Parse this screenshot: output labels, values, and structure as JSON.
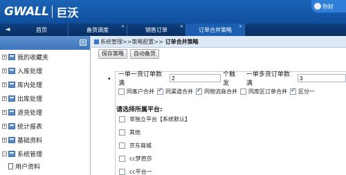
{
  "header": {
    "logo_text": "GWALL",
    "logo_cn": "巨沃",
    "user_label": "你好"
  },
  "tabs": [
    {
      "label": "首页",
      "closable": false
    },
    {
      "label": "备货调度",
      "closable": true
    },
    {
      "label": "销售订单",
      "closable": true
    },
    {
      "label": "订单合并策略",
      "closable": true,
      "active": true
    }
  ],
  "sidebar": {
    "items": [
      {
        "label": "我的收藏夹",
        "expanded": false
      },
      {
        "label": "入库处理",
        "expanded": false
      },
      {
        "label": "库内处理",
        "expanded": false
      },
      {
        "label": "出库处理",
        "expanded": false
      },
      {
        "label": "退货处理",
        "expanded": false
      },
      {
        "label": "统计报表",
        "expanded": false
      },
      {
        "label": "基础资料",
        "expanded": false
      },
      {
        "label": "系统管理",
        "expanded": true
      }
    ],
    "sub_items": [
      {
        "label": "用户资料"
      }
    ]
  },
  "main": {
    "breadcrumb": "系统管理>>策略配置>>",
    "breadcrumb_current": "订单合并策略",
    "toolbar": {
      "save_label": "保存策略",
      "auto_stock_label": "自动备货"
    },
    "rule": {
      "single_sku_label": "一单一货订单数满",
      "single_sku_value": "2",
      "trigger_label": "个触发",
      "multi_sku_label": "一单多货订单数满",
      "multi_sku_value": "3"
    },
    "merge_options": [
      {
        "label": "同客户合并",
        "checked": false
      },
      {
        "label": "同渠道合并",
        "checked": true
      },
      {
        "label": "同物流商合并",
        "checked": true
      },
      {
        "label": "同库区订单合并",
        "checked": false
      },
      {
        "label": "区分一",
        "checked": true
      }
    ],
    "platform_title": "请选择所属平台:",
    "platforms": [
      {
        "label": "非独立平台【系统默认】",
        "checked": false
      },
      {
        "label": "其他",
        "checked": false
      },
      {
        "label": "京东商城",
        "checked": false
      },
      {
        "label": "cc梦芭莎",
        "checked": false
      },
      {
        "label": "cc平台一",
        "checked": false
      }
    ]
  }
}
